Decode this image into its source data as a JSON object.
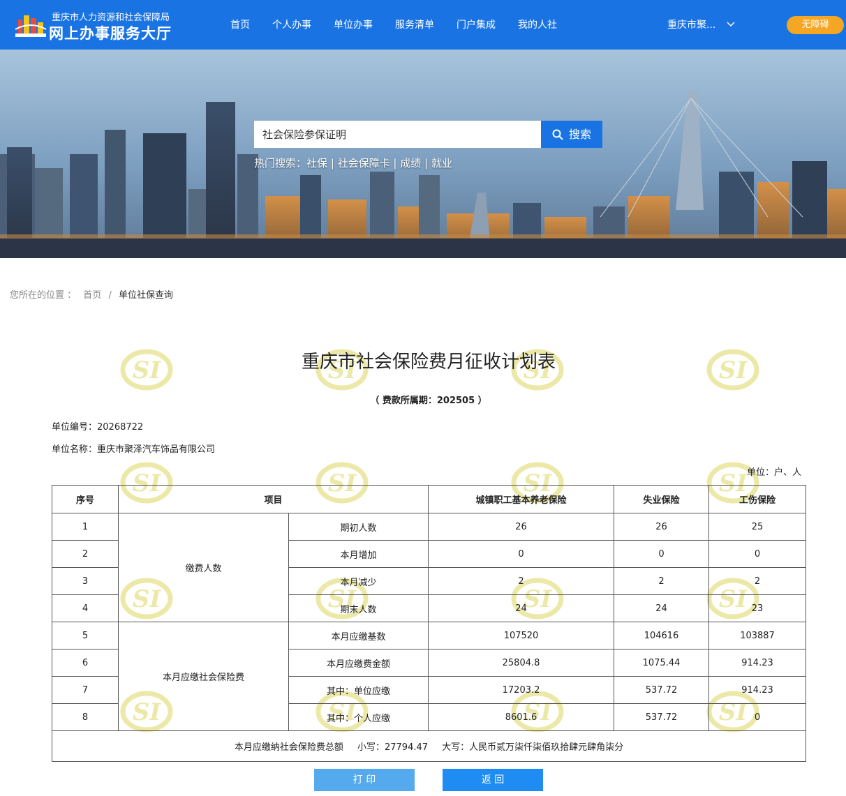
{
  "header": {
    "org_name": "重庆市人力资源和社会保障局",
    "hall_name": "网上办事服务大厅",
    "nav": [
      "首页",
      "个人办事",
      "单位办事",
      "服务清单",
      "门户集成",
      "我的人社"
    ],
    "city": "重庆市聚...",
    "accessibility_label": "无障碍"
  },
  "search": {
    "value": "社会保险参保证明",
    "button_label": "搜索",
    "hot_prefix": "热门搜索：",
    "hot_terms": [
      "社保",
      "社会保障卡",
      "成绩",
      "就业"
    ],
    "hot_separator": " | "
  },
  "breadcrumb": {
    "prefix": "您所在的位置 ：",
    "home": "首页",
    "separator": "/",
    "current": "单位社保查询"
  },
  "watermark_text": "SI",
  "document": {
    "title": "重庆市社会保险费月征收计划表",
    "period": "（ 费款所属期：202505 ）",
    "unit_no": "单位编号：20268722",
    "unit_name": "单位名称：重庆市聚泽汽车饰品有限公司",
    "units": "单位：户、人",
    "headers": [
      "序号",
      "项目",
      "城镇职工基本养老保险",
      "失业保险",
      "工伤保险"
    ],
    "groups": [
      "缴费人数",
      "本月应缴社会保险费"
    ],
    "rows": [
      {
        "no": "1",
        "item": "期初人数",
        "pension": "26",
        "unemployment": "26",
        "injury": "25"
      },
      {
        "no": "2",
        "item": "本月增加",
        "pension": "0",
        "unemployment": "0",
        "injury": "0"
      },
      {
        "no": "3",
        "item": "本月减少",
        "pension": "2",
        "unemployment": "2",
        "injury": "2"
      },
      {
        "no": "4",
        "item": "期末人数",
        "pension": "24",
        "unemployment": "24",
        "injury": "23"
      },
      {
        "no": "5",
        "item": "本月应缴基数",
        "pension": "107520",
        "unemployment": "104616",
        "injury": "103887"
      },
      {
        "no": "6",
        "item": "本月应缴费金额",
        "pension": "25804.8",
        "unemployment": "1075.44",
        "injury": "914.23"
      },
      {
        "no": "7",
        "item": "其中：单位应缴",
        "pension": "17203.2",
        "unemployment": "537.72",
        "injury": "914.23"
      },
      {
        "no": "8",
        "item": "其中：个人应缴",
        "pension": "8601.6",
        "unemployment": "537.72",
        "injury": "0"
      }
    ],
    "total_label": "本月应缴纳社会保险费总额",
    "total_small": "小写：27794.47",
    "total_big": "大写：人民币贰万柒仟柒佰玖拾肆元肆角柒分"
  },
  "buttons": {
    "print": "打 印",
    "back": "返 回"
  },
  "colors": {
    "brand_blue": "#1a73e3",
    "accessibility_orange": "#f5a623",
    "print_button": "#55aaee",
    "back_button": "#1e8cf2"
  }
}
